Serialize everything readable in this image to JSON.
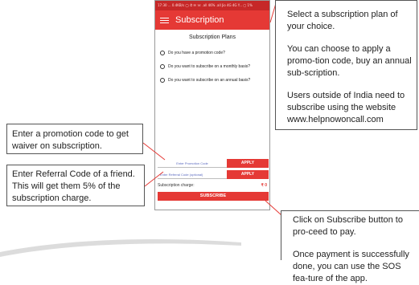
{
  "status_bar": "17:30 ... 0.4KB/s ◯ ⏱ ✉ ☏ .all 46% .all Jio 4G 4G Y... ▢ 1%",
  "app_bar": {
    "title": "Subscription",
    "menu_icon": "hamburger-icon"
  },
  "plans": {
    "heading": "Subscription Plans",
    "options": [
      "Do you have a promotion code?",
      "Do you want to subscribe on a monthly basis?",
      "Do you want to subscribe on an annual basis?"
    ]
  },
  "promo": {
    "placeholder": "Enter Promotion Code",
    "apply_label": "APPLY"
  },
  "referral": {
    "placeholder": "Enter Referral Code (optional)",
    "apply_label": "APPLY"
  },
  "charge": {
    "label": "Subscription charge:",
    "value": "₹ 0"
  },
  "subscribe_label": "SUBSCRIBE",
  "callouts": {
    "plan": {
      "p1": "Select a subscription plan of your choice.",
      "p2": "You can choose to apply a promo-tion code, buy an annual sub-scription.",
      "p3": "Users outside of India need to subscribe using the website www.helpnowoncall.com"
    },
    "promo": "Enter a promotion code to get waiver on subscription.",
    "referral": "Enter Referral Code of a friend. This will get them 5% of the subscription charge.",
    "subscribe": {
      "p1": "Click on Subscribe button to pro-ceed to pay.",
      "p2": "Once payment is successfully done, you can use the SOS fea-ture of the app."
    }
  }
}
